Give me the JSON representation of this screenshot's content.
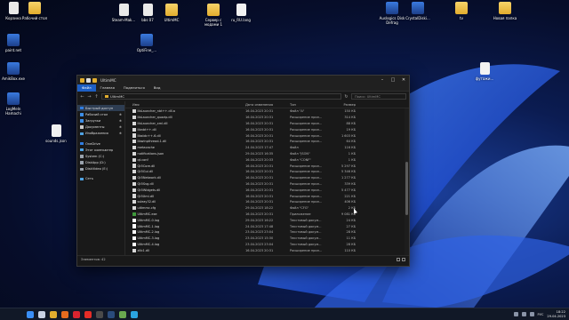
{
  "desktop": {
    "icons": [
      {
        "label": "Корзина",
        "kind": "bin"
      },
      {
        "label": "Рабочий стол",
        "kind": "folder"
      },
      {
        "label": "Steam-Mak...",
        "kind": "file"
      },
      {
        "label": "bbs 07",
        "kind": "file"
      },
      {
        "label": "UltimMC",
        "kind": "folder"
      },
      {
        "label": "Сервер с модами 1",
        "kind": "folder"
      },
      {
        "label": "ru_RU.lang",
        "kind": "doc"
      },
      {
        "label": "Auslogics Disk Defrag",
        "kind": "app"
      },
      {
        "label": "CrystalDiski...",
        "kind": "app"
      },
      {
        "label": "tv",
        "kind": "folder"
      },
      {
        "label": "Новая папка",
        "kind": "folder"
      },
      {
        "label": "paint.net",
        "kind": "app"
      },
      {
        "label": "OptiFine_...",
        "kind": "app"
      },
      {
        "label": "AmikBox.exe",
        "kind": "app"
      },
      {
        "label": "футажи...",
        "kind": "doc"
      },
      {
        "label": "LogMeIn Hamachi",
        "kind": "app"
      },
      {
        "label": "sounds.json",
        "kind": "doc"
      }
    ]
  },
  "window": {
    "title": "UltimMC",
    "ribbon_tabs": [
      "Файл",
      "Главная",
      "Поделиться",
      "Вид"
    ],
    "address_path": "UltimMC",
    "search_placeholder": "Поиск: UltimMC",
    "nav_items": [
      {
        "label": "Быстрый доступ",
        "icon": "star-icon",
        "color": "#2f7de1",
        "pin": "",
        "selected": true
      },
      {
        "label": "Рабочий стол",
        "icon": "desktop-icon",
        "color": "#3d8ee8",
        "pin": "✱",
        "selected": false
      },
      {
        "label": "Загрузки",
        "icon": "download-icon",
        "color": "#3d8ee8",
        "pin": "✱",
        "selected": false
      },
      {
        "label": "Документы",
        "icon": "document-icon",
        "color": "#c9c9c9",
        "pin": "✱",
        "selected": false
      },
      {
        "label": "Изображения",
        "icon": "image-icon",
        "color": "#4fa3e3",
        "pin": "✱",
        "selected": false
      },
      {
        "label": "OneDrive",
        "icon": "cloud-icon",
        "color": "#2f7de1",
        "pin": "",
        "selected": false,
        "gap": true
      },
      {
        "label": "Этот компьютер",
        "icon": "computer-icon",
        "color": "#4fa3e3",
        "pin": "",
        "selected": false
      },
      {
        "label": "System (C:)",
        "icon": "drive-icon",
        "color": "#9aa3ad",
        "pin": "",
        "selected": false
      },
      {
        "label": "DiskApp (D:)",
        "icon": "drive-icon",
        "color": "#9aa3ad",
        "pin": "",
        "selected": false
      },
      {
        "label": "DiskVideo (E:)",
        "icon": "drive-icon",
        "color": "#9aa3ad",
        "pin": "",
        "selected": false
      },
      {
        "label": "Сеть",
        "icon": "network-icon",
        "color": "#4fa3e3",
        "pin": "",
        "selected": false,
        "gap": true
      }
    ],
    "columns": {
      "name": "Имя",
      "date": "Дата изменения",
      "type": "Тип",
      "size": "Размер"
    },
    "files": [
      {
        "name": "libLauncher_nbt++.dll.a",
        "date": "16.04.2023 20:31",
        "type": "Файл \"A\"",
        "size": "150 КБ",
        "kind": "file"
      },
      {
        "name": "libLauncher_quazip.dll",
        "date": "16.04.2023 20:31",
        "type": "Расширение прил...",
        "size": "314 КБ",
        "kind": "file"
      },
      {
        "name": "libLauncher_xml.dll",
        "date": "16.04.2023 20:31",
        "type": "Расширение прил...",
        "size": "88 КБ",
        "kind": "file"
      },
      {
        "name": "libnbt++.dll",
        "date": "16.04.2023 20:31",
        "type": "Расширение прил...",
        "size": "19 КБ",
        "kind": "file"
      },
      {
        "name": "libstdc++-6.dll",
        "date": "16.04.2023 20:31",
        "type": "Расширение прил...",
        "size": "1 603 КБ",
        "kind": "file"
      },
      {
        "name": "libwinpthread-1.dll",
        "date": "16.04.2023 20:31",
        "type": "Расширение прил...",
        "size": "64 КБ",
        "kind": "file"
      },
      {
        "name": "metacache",
        "date": "24.04.2023 17:47",
        "type": "Файл",
        "size": "116 КБ",
        "kind": "file"
      },
      {
        "name": "notifications.json",
        "date": "29.04.2023 16:35",
        "type": "Файл \"JSON\"",
        "size": "1 КБ",
        "kind": "file"
      },
      {
        "name": "qt.conf",
        "date": "16.04.2023 20:33",
        "type": "Файл \"CONF\"",
        "size": "1 КБ",
        "kind": "file"
      },
      {
        "name": "Qt5Core.dll",
        "date": "16.04.2023 20:31",
        "type": "Расширение прил...",
        "size": "5 297 КБ",
        "kind": "file"
      },
      {
        "name": "Qt5Gui.dll",
        "date": "16.04.2023 20:31",
        "type": "Расширение прил...",
        "size": "5 346 КБ",
        "kind": "file"
      },
      {
        "name": "Qt5Network.dll",
        "date": "16.04.2023 20:31",
        "type": "Расширение прил...",
        "size": "1 277 КБ",
        "kind": "file"
      },
      {
        "name": "Qt5Svg.dll",
        "date": "16.04.2023 20:31",
        "type": "Расширение прил...",
        "size": "339 КБ",
        "kind": "file"
      },
      {
        "name": "Qt5Widgets.dll",
        "date": "16.04.2023 20:31",
        "type": "Расширение прил...",
        "size": "5 477 КБ",
        "kind": "file"
      },
      {
        "name": "Qt5Xml.dll",
        "date": "16.04.2023 20:31",
        "type": "Расширение прил...",
        "size": "221 КБ",
        "kind": "file"
      },
      {
        "name": "ssleay32.dll",
        "date": "16.04.2023 20:31",
        "type": "Расширение прил...",
        "size": "406 КБ",
        "kind": "file"
      },
      {
        "name": "ultimmc.cfg",
        "date": "29.04.2023 18:22",
        "type": "Файл \"CFG\"",
        "size": "2 КБ",
        "kind": "file"
      },
      {
        "name": "UltimMC.exe",
        "date": "16.04.2023 20:31",
        "type": "Приложение",
        "size": "9 081 КБ",
        "kind": "exe"
      },
      {
        "name": "UltimMC-0.log",
        "date": "29.04.2023 16:22",
        "type": "Текстовый докум...",
        "size": "24 КБ",
        "kind": "txt"
      },
      {
        "name": "UltimMC-1.log",
        "date": "24.04.2023 17:48",
        "type": "Текстовый докум...",
        "size": "27 КБ",
        "kind": "txt"
      },
      {
        "name": "UltimMC-2.log",
        "date": "23.04.2023 23:04",
        "type": "Текстовый докум...",
        "size": "28 КБ",
        "kind": "txt"
      },
      {
        "name": "UltimMC-3.log",
        "date": "23.04.2023 15:30",
        "type": "Текстовый докум...",
        "size": "11 КБ",
        "kind": "txt"
      },
      {
        "name": "UltimMC-4.log",
        "date": "23.04.2023 23:04",
        "type": "Текстовый докум...",
        "size": "28 КБ",
        "kind": "txt"
      },
      {
        "name": "zlib1.dll",
        "date": "16.04.2023 20:31",
        "type": "Расширение прил...",
        "size": "110 КБ",
        "kind": "file"
      }
    ],
    "status_text": "Элементов: 42"
  },
  "taskbar": {
    "apps": [
      "start-icon",
      "search-icon",
      "explorer-icon",
      "firefox-icon",
      "opera-icon",
      "youtube-icon",
      "obs-icon",
      "steam-icon",
      "minecraft-icon",
      "telegram-icon"
    ],
    "app_colors": [
      "#3a8ef6",
      "#c9d2e3",
      "#e2ad2e",
      "#e66b1e",
      "#d9242f",
      "#e52d27",
      "#4a4a4a",
      "#2a4b7c",
      "#6aa84f",
      "#2aa3e0"
    ],
    "lang": "РУС",
    "time": "18:22",
    "date": "29.04.2023"
  }
}
